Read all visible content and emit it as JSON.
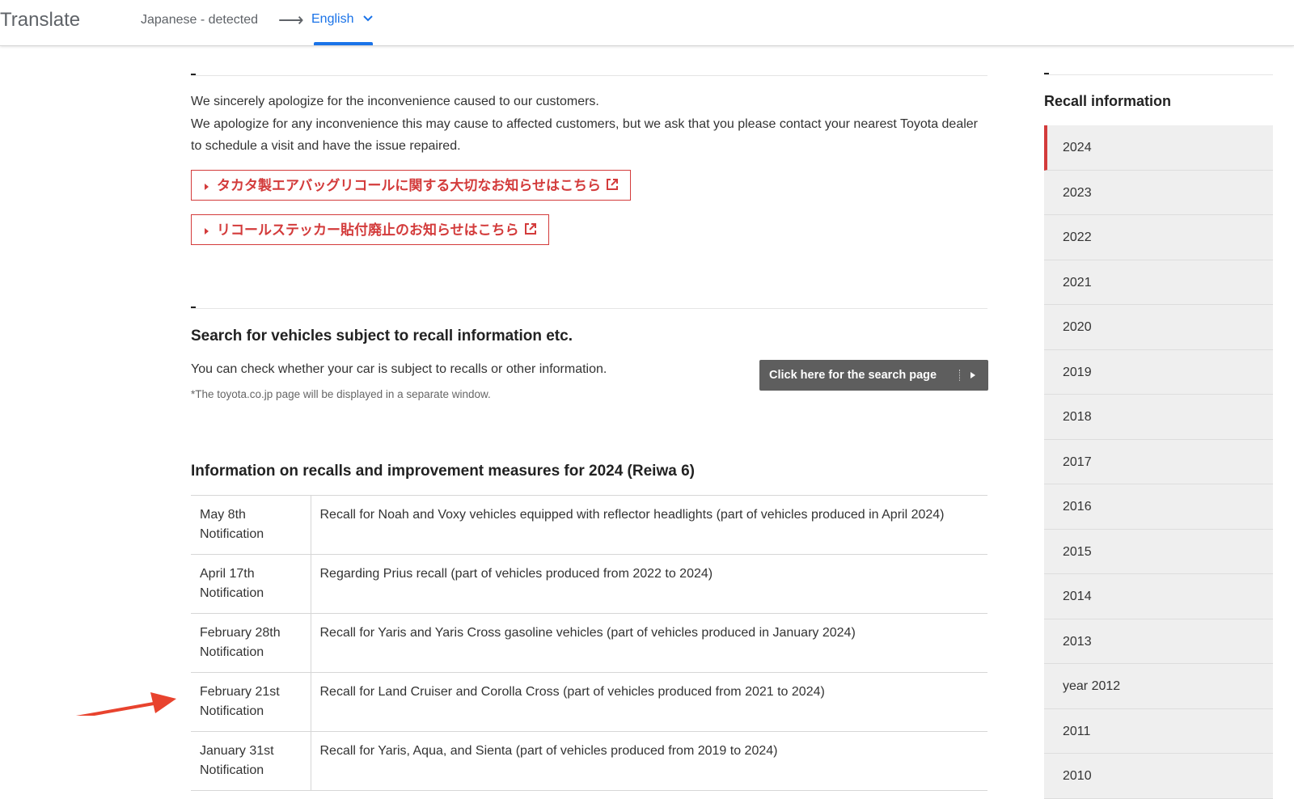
{
  "translate_bar": {
    "brand": "Translate",
    "source_language": "Japanese - detected",
    "arrow": "⟶",
    "target_language": "English",
    "accent_color": "#1a73e8"
  },
  "intro": {
    "line1": "We sincerely apologize for the inconvenience caused to our customers.",
    "line2": "We apologize for any inconvenience this may cause to affected customers, but we ask that you please contact your nearest Toyota dealer to schedule a visit and have the issue repaired."
  },
  "links": {
    "takata": "タカタ製エアバッグリコールに関する大切なお知らせはこちら",
    "sticker": "リコールステッカー貼付廃止のお知らせはこちら",
    "color": "#d33b3b"
  },
  "search": {
    "heading": "Search for vehicles subject to recall information etc.",
    "description": "You can check whether your car is subject to recalls or other information.",
    "note": "*The toyota.co.jp page will be displayed in a separate window.",
    "button_label": "Click here for the search page"
  },
  "recalls": {
    "heading": "Information on recalls and improvement measures for 2024 (Reiwa 6)",
    "rows": [
      {
        "date_line1": "May 8th",
        "date_line2": "Notification",
        "text": "Recall for Noah and Voxy vehicles equipped with reflector headlights (part of vehicles produced in April 2024)"
      },
      {
        "date_line1": "April 17th",
        "date_line2": "Notification",
        "text": "Regarding Prius recall (part of vehicles produced from 2022 to 2024)"
      },
      {
        "date_line1": "February 28th",
        "date_line2": "Notification",
        "text": "Recall for Yaris and Yaris Cross gasoline vehicles (part of vehicles produced in January 2024)"
      },
      {
        "date_line1": "February 21st",
        "date_line2": "Notification",
        "text": "Recall for Land Cruiser and Corolla Cross (part of vehicles produced from 2021 to 2024)"
      },
      {
        "date_line1": "January 31st",
        "date_line2": "Notification",
        "text": "Recall for Yaris, Aqua, and Sienta (part of vehicles produced from 2019 to 2024)"
      }
    ]
  },
  "sidebar": {
    "title": "Recall information",
    "years": [
      "2024",
      "2023",
      "2022",
      "2021",
      "2020",
      "2019",
      "2018",
      "2017",
      "2016",
      "2015",
      "2014",
      "2013",
      "year 2012",
      "2011",
      "2010"
    ],
    "active_year": "2024",
    "active_color": "#d33b3b"
  },
  "annotation": {
    "color": "#e8432e"
  }
}
